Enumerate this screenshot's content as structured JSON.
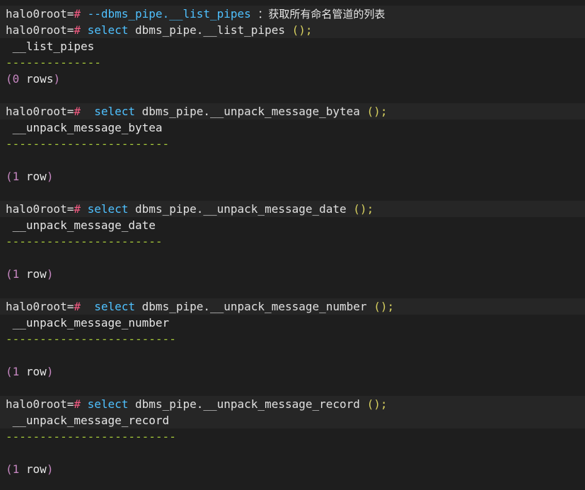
{
  "prompt": "halo0root=",
  "hash": "#",
  "blocks": [
    {
      "comment_code": " --dbms_pipe.__list_pipes ",
      "comment_text": "：获取所有命名管道的列表",
      "keyword": " select",
      "call": " dbms_pipe.__list_pipes ",
      "parens": "();",
      "column_header": " __list_pipes",
      "dashes": "--------------",
      "result_count": "0",
      "result_word": " rows"
    },
    {
      "keyword": "  select",
      "call": " dbms_pipe.__unpack_message_bytea ",
      "parens": "();",
      "column_header": " __unpack_message_bytea",
      "dashes": "------------------------",
      "result_count": "1",
      "result_word": " row"
    },
    {
      "keyword": " select",
      "call": " dbms_pipe.__unpack_message_date ",
      "parens": "();",
      "column_header": " __unpack_message_date",
      "dashes": "-----------------------",
      "result_count": "1",
      "result_word": " row"
    },
    {
      "keyword": "  select",
      "call": " dbms_pipe.__unpack_message_number ",
      "parens": "();",
      "column_header": " __unpack_message_number",
      "dashes": "-------------------------",
      "result_count": "1",
      "result_word": " row"
    },
    {
      "keyword": " select",
      "call": " dbms_pipe.__unpack_message_record ",
      "parens": "();",
      "column_header": " __unpack_message_record",
      "dashes": "-------------------------",
      "result_count": "1",
      "result_word": " row"
    }
  ],
  "colors": {
    "background": "#1e1e1e",
    "highlight": "#262626",
    "prompt_hash": "#f45b83",
    "keyword": "#4fc1ff",
    "parens": "#d7d05f",
    "dashes": "#a6c93a",
    "count_parens": "#c586c0"
  }
}
